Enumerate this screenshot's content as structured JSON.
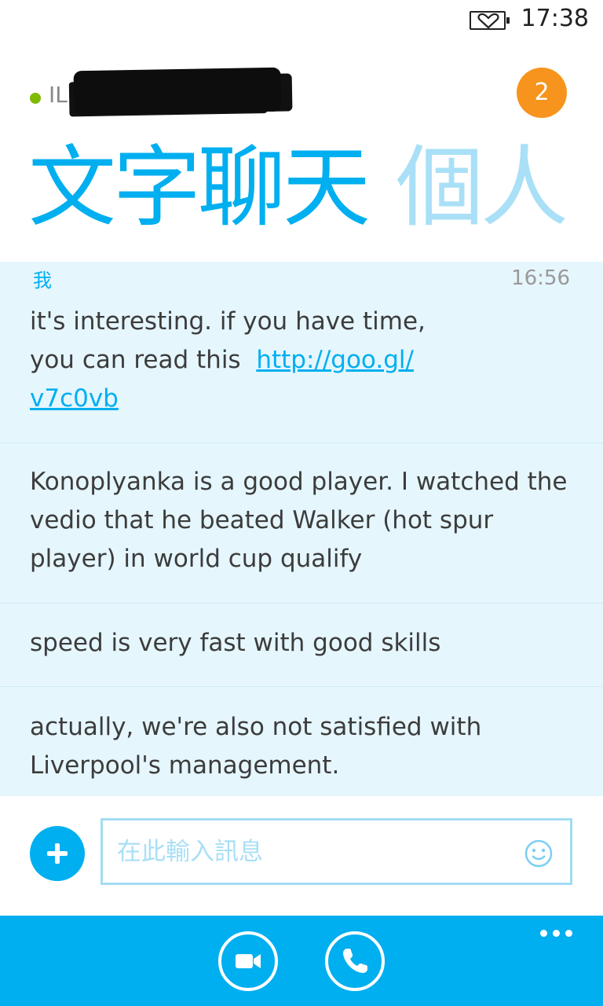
{
  "status_bar": {
    "time": "17:38",
    "battery_icon": "battery-heart-icon"
  },
  "contact": {
    "name": "IL",
    "presence": "online",
    "presence_color": "#7fba00",
    "unread_badge": "2"
  },
  "pivot": {
    "tabs": [
      {
        "label": "文字聊天",
        "active": true
      },
      {
        "label": "個人",
        "active": false
      }
    ]
  },
  "conversation": {
    "sender": "我",
    "timestamp": "16:56",
    "messages": [
      {
        "text_before": "it's interesting. if you have time,",
        "text_line2": "you can read this ",
        "link": "http://goo.gl/v7c0vb",
        "link_line1": "http://goo.gl/",
        "link_line2": "v7c0vb"
      },
      {
        "text": "Konoplyanka is a good player. I watched the vedio that he beated Walker (hot spur player) in world cup qualify"
      },
      {
        "text": "speed is very fast with good skills"
      },
      {
        "text": "actually, we're also not satisfied with Liverpool's management."
      }
    ]
  },
  "compose": {
    "placeholder": "在此輸入訊息",
    "add_icon": "plus-icon",
    "emoji_icon": "smiley-icon"
  },
  "app_bar": {
    "video_icon": "video-camera-icon",
    "call_icon": "phone-icon",
    "more_icon": "more-dots-icon"
  },
  "colors": {
    "accent": "#00aff0",
    "accent_light": "#a9e0f7",
    "bubble_bg": "#e5f6fd",
    "badge": "#f7941d"
  }
}
